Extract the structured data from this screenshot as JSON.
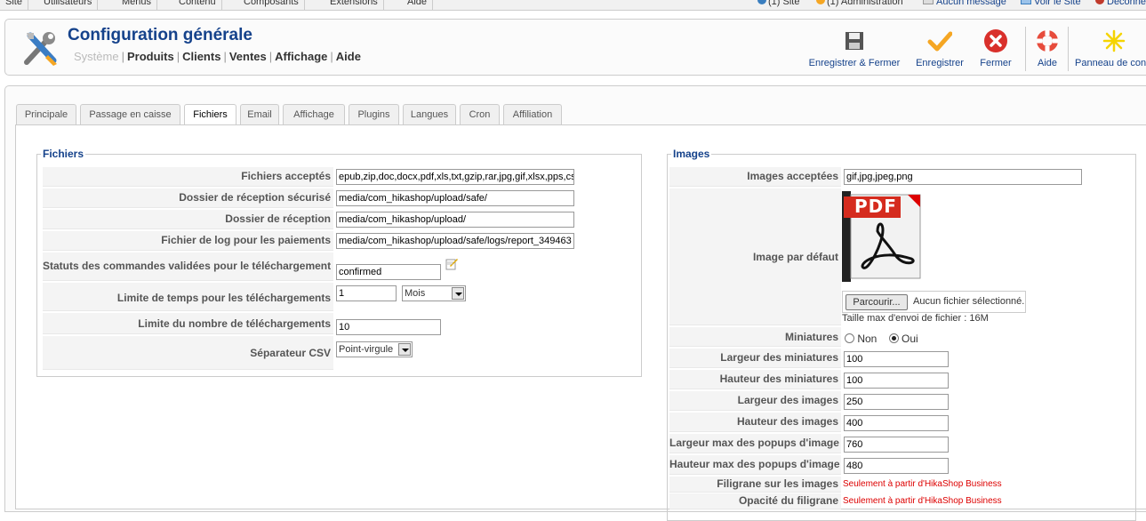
{
  "top_menu": {
    "items": [
      "Site",
      "Utilisateurs",
      "Menus",
      "Contenu",
      "Composants",
      "Extensions",
      "Aide"
    ],
    "status": [
      {
        "label": "(1) Site",
        "icon": "users-icon"
      },
      {
        "label": "(1) Administration",
        "icon": "admin-icon"
      },
      {
        "label": "Aucun message",
        "icon": "mail-icon"
      },
      {
        "label": "Voir le Site",
        "icon": "view-site-icon"
      },
      {
        "label": "Déconnexion",
        "icon": "logout-icon"
      }
    ]
  },
  "header": {
    "title": "Configuration générale",
    "submenu": [
      "Système",
      "Produits",
      "Clients",
      "Ventes",
      "Affichage",
      "Aide"
    ]
  },
  "toolbar": {
    "save_close": "Enregistrer & Fermer",
    "save": "Enregistrer",
    "close": "Fermer",
    "help": "Aide",
    "dashboard": "Panneau de contrôle"
  },
  "tabs": [
    "Principale",
    "Passage en caisse",
    "Fichiers",
    "Email",
    "Affichage",
    "Plugins",
    "Langues",
    "Cron",
    "Affiliation"
  ],
  "active_tab": "Fichiers",
  "files": {
    "legend": "Fichiers",
    "accepted_label": "Fichiers acceptés",
    "accepted_value": "epub,zip,doc,docx,pdf,xls,txt,gzip,rar,jpg,gif,xlsx,pps,csv",
    "secure_folder_label": "Dossier de réception sécurisé",
    "secure_folder_value": "media/com_hikashop/upload/safe/",
    "folder_label": "Dossier de réception",
    "folder_value": "media/com_hikashop/upload/",
    "log_label": "Fichier de log pour les paiements",
    "log_value": "media/com_hikashop/upload/safe/logs/report_349463",
    "statuses_label": "Statuts des commandes validées pour le téléchargement",
    "statuses_value": "confirmed",
    "time_limit_label": "Limite de temps pour les téléchargements",
    "time_limit_value": "1",
    "time_limit_unit": "Mois",
    "count_limit_label": "Limite du nombre de téléchargements",
    "count_limit_value": "10",
    "csv_sep_label": "Séparateur CSV",
    "csv_sep_value": "Point-virgule"
  },
  "images": {
    "legend": "Images",
    "accepted_label": "Images acceptées",
    "accepted_value": "gif,jpg,jpeg,png",
    "default_label": "Image par défaut",
    "pdf_text": "PDF",
    "browse_label": "Parcourir...",
    "no_file": "Aucun fichier sélectionné.",
    "max_size": "Taille max d'envoi de fichier : 16M",
    "thumbs_label": "Miniatures",
    "thumbs_no": "Non",
    "thumbs_yes": "Oui",
    "thumbs_value": "Oui",
    "thumb_width_label": "Largeur des miniatures",
    "thumb_width_value": "100",
    "thumb_height_label": "Hauteur des miniatures",
    "thumb_height_value": "100",
    "img_width_label": "Largeur des images",
    "img_width_value": "250",
    "img_height_label": "Hauteur des images",
    "img_height_value": "400",
    "popup_width_label": "Largeur max des popups d'image",
    "popup_width_value": "760",
    "popup_height_label": "Hauteur max des popups d'image",
    "popup_height_value": "480",
    "watermark_label": "Filigrane sur les images",
    "watermark_note": "Seulement à partir d'HikaShop Business",
    "opacity_label": "Opacité du filigrane",
    "opacity_note": "Seulement à partir d'HikaShop Business"
  },
  "colors": {
    "title": "#15428b",
    "warning": "#dd0000",
    "accent": "#f5a623"
  }
}
